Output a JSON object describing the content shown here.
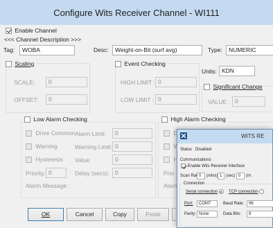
{
  "window": {
    "title": "Configure Wits Receiver Channel - WI111"
  },
  "channel": {
    "enable_label": "Enable Channel",
    "enable_checked": true,
    "description_header": "<<< Channel Description >>>",
    "tag_label": "Tag:",
    "tag_value": "WOBA",
    "desc_label": "Desc:",
    "desc_value": "Weight-on-Bit (surf avg)",
    "type_label": "Type:",
    "type_value": "NUMERIC"
  },
  "scaling": {
    "label": "Scaling",
    "checked": false,
    "scale_label": "SCALE:",
    "scale_value": "0",
    "offset_label": "OFFSET:",
    "offset_value": "0"
  },
  "event_checking": {
    "label": "Event Checking",
    "checked": false,
    "high_limit_label": "HIGH LIMIT :",
    "high_limit_value": "0",
    "low_limit_label": "LOW LIMIT :",
    "low_limit_value": "0"
  },
  "units": {
    "label": "Units:",
    "value": "KDN"
  },
  "significant_change": {
    "label": "Significant Change",
    "checked": false,
    "value_label": "VALUE :",
    "value": "0"
  },
  "low_alarm": {
    "label": "Low Alarm Checking",
    "checked": false,
    "drive_common": "Drive Common",
    "warning": "Warning",
    "hysteresis": "Hysteresis",
    "alarm_limit_label": "Alarm Limit:",
    "alarm_limit_value": "0",
    "warning_limit_label": "Warning Limit:",
    "warning_limit_value": "0",
    "value_label": "Value:",
    "value_value": "0",
    "priority_label": "Priority:",
    "priority_value": "0",
    "delay_label": "Delay (secs):",
    "delay_value": "0",
    "message_label": "Alarm Message :"
  },
  "high_alarm": {
    "label": "High Alarm Checking",
    "checked": false,
    "drive_partial": "Dri",
    "warning_partial": "W",
    "hysteresis_partial": "Hy",
    "priority_partial": "Prio",
    "message_partial": "Alarm"
  },
  "buttons": {
    "ok": "OK",
    "cancel": "Cancel",
    "copy": "Copy",
    "paste": "Paste"
  },
  "wits_window": {
    "title": "WITS RE",
    "status_label": "Status",
    "status_value": "Disabled",
    "communications": "Communications",
    "enable_receiver": "Enable Wits Receiver Interface",
    "enable_receiver_checked": true,
    "scan_rate_label": "Scan Rate",
    "scan_rate_mins": "0",
    "mins_label": "(mins)",
    "scan_rate_sec": "1",
    "sec_label": "(sec)",
    "scan_rate_ms": "0",
    "ms_partial": "(m",
    "connection_label": "Connection",
    "serial_label": "Serial connection",
    "tcp_label": "TCP connection",
    "port_label": "Port:",
    "port_value": "COM7",
    "baud_label": "Baud Rate:",
    "baud_value": "96",
    "parity_label": "Parity:",
    "parity_value": "None",
    "data_bits_label": "Data Bits:",
    "data_bits_value": "8"
  },
  "colors": {
    "titlebar": "#c4daf0",
    "dialog_bg": "#f0f0f0",
    "group_border": "#d5dfe5"
  }
}
